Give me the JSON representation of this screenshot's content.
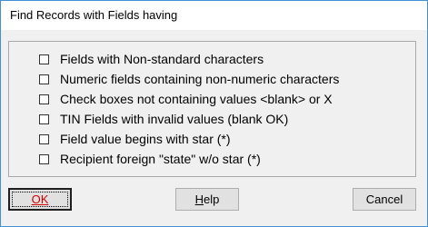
{
  "window": {
    "title": "Find Records with Fields having"
  },
  "options": [
    {
      "label": "Fields with Non-standard characters",
      "checked": false
    },
    {
      "label": "Numeric fields containing non-numeric characters",
      "checked": false
    },
    {
      "label": "Check boxes not containing values <blank> or X",
      "checked": false
    },
    {
      "label": "TIN Fields with invalid values (blank OK)",
      "checked": false
    },
    {
      "label": "Field value begins with star (*)",
      "checked": false
    },
    {
      "label": "Recipient foreign \"state\" w/o star (*)",
      "checked": false
    }
  ],
  "buttons": {
    "ok": {
      "label": "OK",
      "color": "#d40000"
    },
    "help": {
      "label_first": "H",
      "label_rest": "elp"
    },
    "cancel": {
      "label": "Cancel"
    }
  },
  "colors": {
    "window_border": "#3f90d4",
    "dialog_bg": "#f0f0f0",
    "ok_text": "#d40000"
  }
}
